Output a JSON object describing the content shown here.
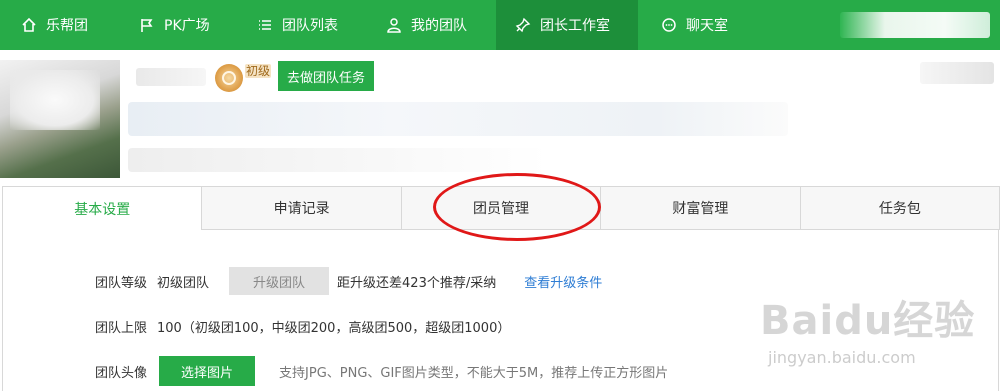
{
  "nav": {
    "items": [
      {
        "label": "乐帮团",
        "icon": "home-icon"
      },
      {
        "label": "PK广场",
        "icon": "flag-icon"
      },
      {
        "label": "团队列表",
        "icon": "list-icon"
      },
      {
        "label": "我的团队",
        "icon": "team-icon"
      },
      {
        "label": "团长工作室",
        "icon": "pin-icon"
      },
      {
        "label": "聊天室",
        "icon": "chat-icon"
      }
    ],
    "active_index": 4
  },
  "profile": {
    "badge_text": "初级",
    "task_button": "去做团队任务"
  },
  "tabs": [
    "基本设置",
    "申请记录",
    "团员管理",
    "财富管理",
    "任务包"
  ],
  "settings": {
    "level": {
      "label": "团队等级",
      "value": "初级团队",
      "button": "升级团队",
      "remaining": "距升级还差423个推荐/采纳",
      "link": "查看升级条件"
    },
    "limit": {
      "label": "团队上限",
      "value": "100（初级团100，中级团200，高级团500，超级团1000）"
    },
    "avatar": {
      "label": "团队头像",
      "button": "选择图片",
      "hint": "支持JPG、PNG、GIF图片类型，不能大于5M，推荐上传正方形图片"
    }
  },
  "watermark": {
    "logo": "Baidu经验",
    "url": "jingyan.baidu.com"
  },
  "colors": {
    "primary": "#27ab48",
    "annotation": "#e01818",
    "link": "#2e7dd4"
  }
}
